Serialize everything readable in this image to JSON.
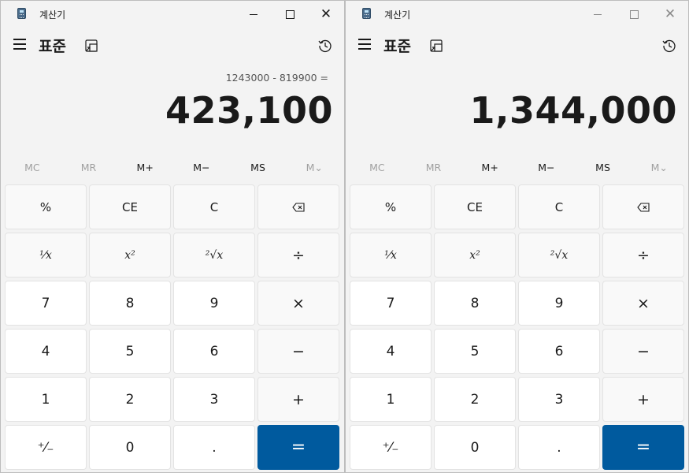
{
  "windows": [
    {
      "title": "계산기",
      "mode": "표준",
      "expression": "1243000 - 819900 =",
      "display": "423,100"
    },
    {
      "title": "계산기",
      "mode": "표준",
      "expression": "",
      "display": "1,344,000"
    }
  ],
  "memory": [
    "MC",
    "MR",
    "M+",
    "M−",
    "MS",
    "M⌄"
  ],
  "keys": {
    "percent": "%",
    "ce": "CE",
    "c": "C",
    "reciprocal": "¹⁄x",
    "square": "x²",
    "sqrt": "²√x",
    "divide": "÷",
    "seven": "7",
    "eight": "8",
    "nine": "9",
    "multiply": "×",
    "four": "4",
    "five": "5",
    "six": "6",
    "minus": "−",
    "one": "1",
    "two": "2",
    "three": "3",
    "plus": "+",
    "negate": "⁺⁄₋",
    "zero": "0",
    "decimal": ".",
    "equals": "="
  },
  "colors": {
    "accent": "#005a9e",
    "background": "#f3f3f3"
  }
}
